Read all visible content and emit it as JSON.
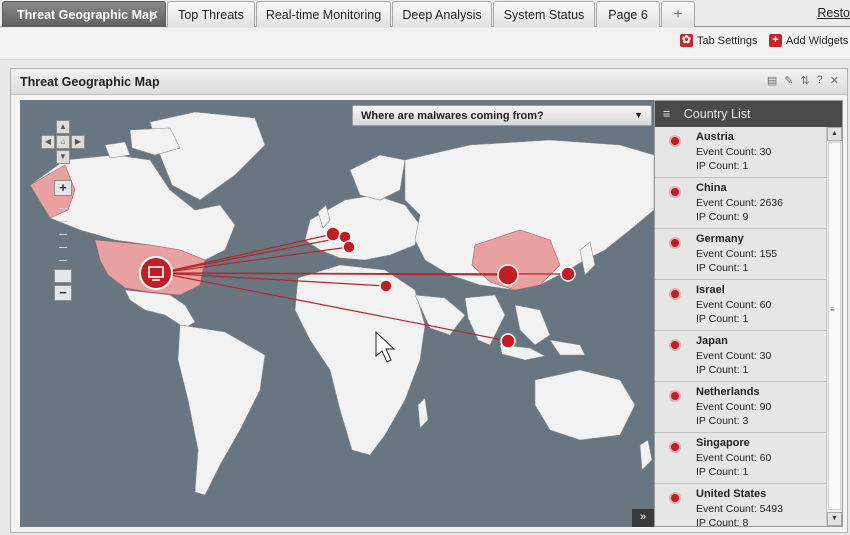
{
  "tabs": [
    {
      "label": "Threat Geographic Map",
      "active": true
    },
    {
      "label": "Top Threats"
    },
    {
      "label": "Real-time Monitoring"
    },
    {
      "label": "Deep Analysis"
    },
    {
      "label": "System Status"
    },
    {
      "label": "Page 6"
    }
  ],
  "tab_add_label": "+",
  "tab_close_label": "✕",
  "restore_label": "Resto",
  "toolbar": {
    "tab_settings": "Tab Settings",
    "add_widgets": "Add Widgets"
  },
  "widget": {
    "title": "Threat Geographic Map",
    "map": {
      "dropdown_label": "Where are malwares coming from?",
      "expand_label": "»",
      "target": "United States",
      "sources": [
        "Austria",
        "China",
        "Germany",
        "Israel",
        "Japan",
        "Netherlands",
        "Singapore"
      ]
    },
    "country_list": {
      "title": "Country List",
      "items": [
        {
          "name": "Austria",
          "event": "Event Count: 30",
          "ip": "IP Count: 1"
        },
        {
          "name": "China",
          "event": "Event Count: 2636",
          "ip": "IP Count: 9"
        },
        {
          "name": "Germany",
          "event": "Event Count: 155",
          "ip": "IP Count: 1"
        },
        {
          "name": "Israel",
          "event": "Event Count: 60",
          "ip": "IP Count: 1"
        },
        {
          "name": "Japan",
          "event": "Event Count: 30",
          "ip": "IP Count: 1"
        },
        {
          "name": "Netherlands",
          "event": "Event Count: 90",
          "ip": "IP Count: 3"
        },
        {
          "name": "Singapore",
          "event": "Event Count: 60",
          "ip": "IP Count: 1"
        },
        {
          "name": "United States",
          "event": "Event Count: 5493",
          "ip": "IP Count: 8"
        }
      ]
    }
  },
  "colors": {
    "accent_red": "#c01e24",
    "ocean": "#687682",
    "land": "#f2f2f2",
    "highlight": "#e8a0a0"
  }
}
